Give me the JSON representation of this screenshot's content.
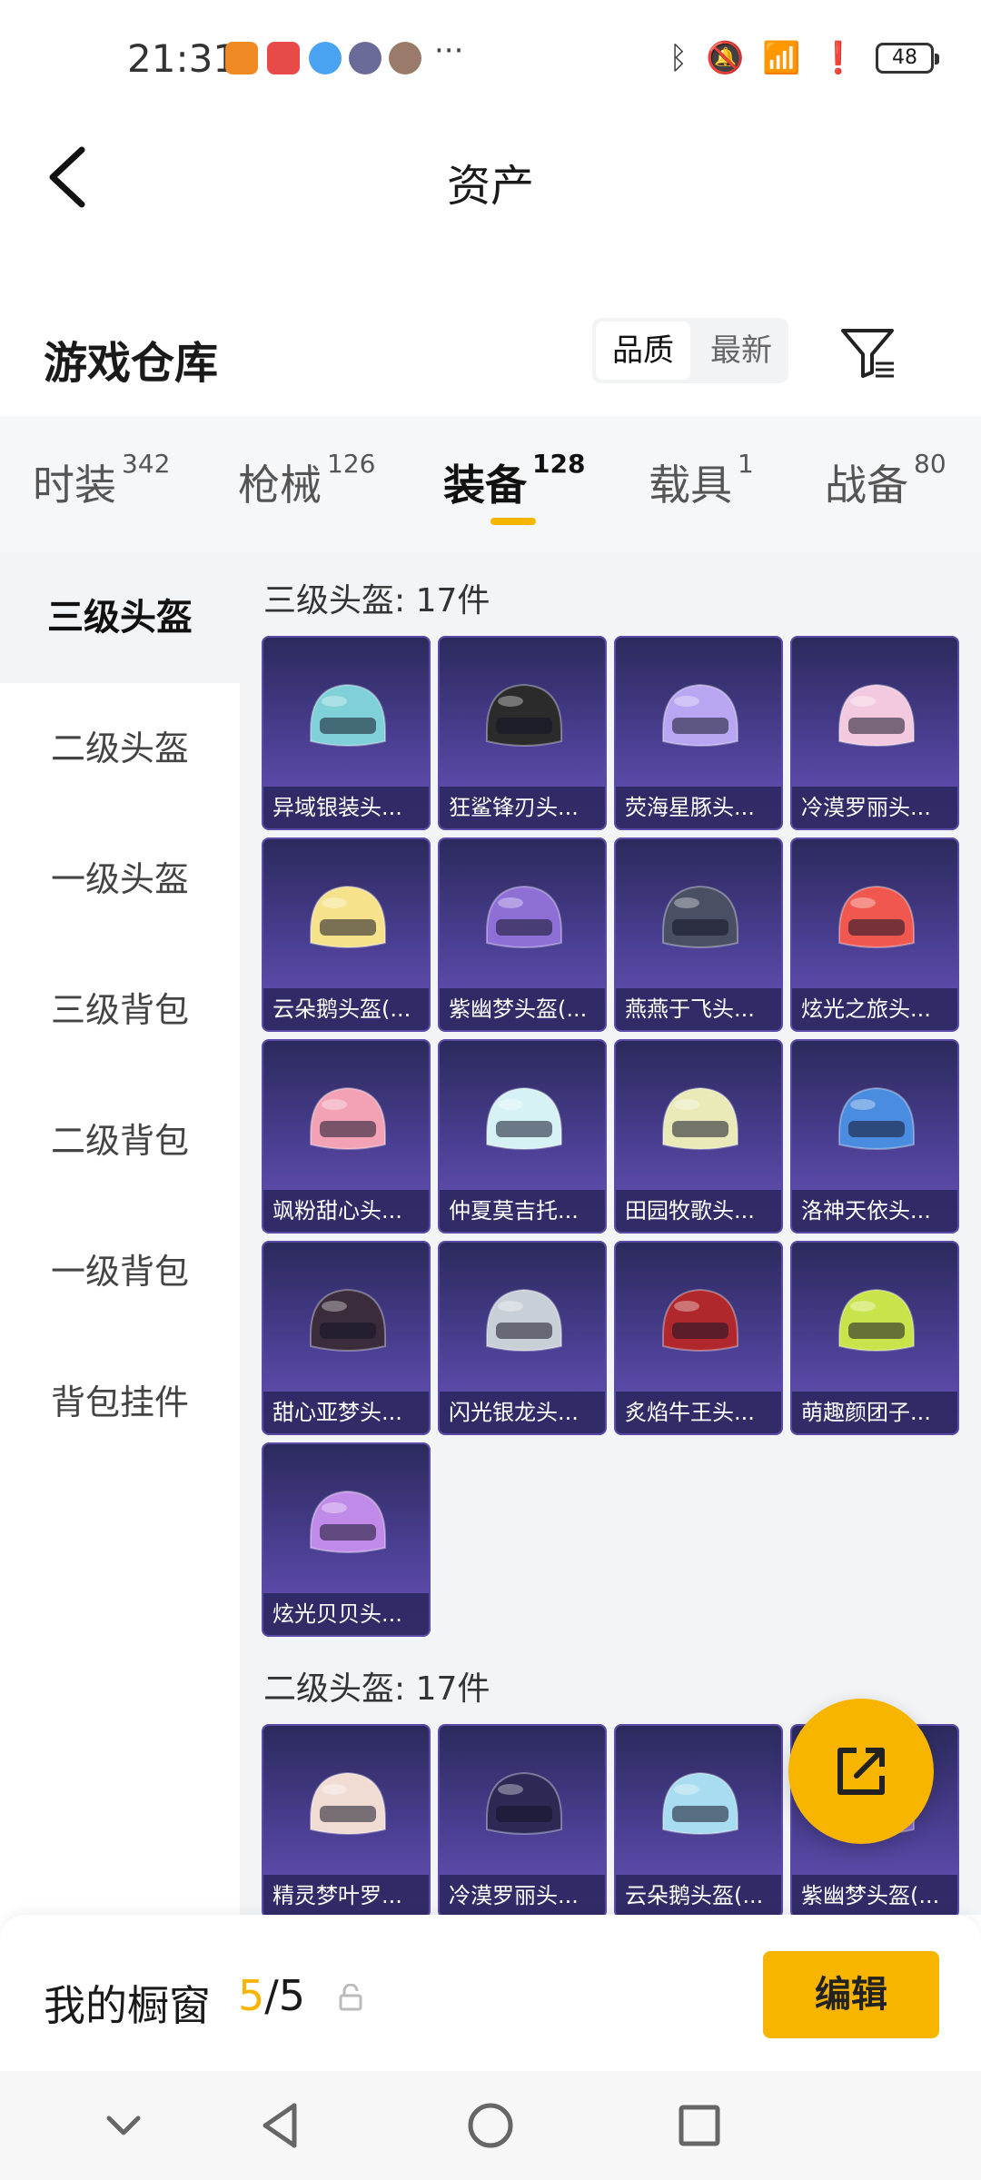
{
  "status": {
    "time": "21:31",
    "battery": "48",
    "notif_colors": [
      "#f08a24",
      "#e84a4a",
      "#4aa3f0",
      "#6b6b9a",
      "#9a7a6b"
    ]
  },
  "header": {
    "title": "资产"
  },
  "section": {
    "title": "游戏仓库",
    "sort_quality": "品质",
    "sort_newest": "最新"
  },
  "tabs": [
    {
      "label": "时装",
      "count": "342"
    },
    {
      "label": "枪械",
      "count": "126"
    },
    {
      "label": "装备",
      "count": "128"
    },
    {
      "label": "载具",
      "count": "1"
    },
    {
      "label": "战备",
      "count": "80"
    }
  ],
  "sidebar": [
    "三级头盔",
    "二级头盔",
    "一级头盔",
    "三级背包",
    "二级背包",
    "一级背包",
    "背包挂件"
  ],
  "groups": [
    {
      "title": "三级头盔: 17件",
      "items": [
        {
          "name": "异域银装头...",
          "color": "#7fd0d8"
        },
        {
          "name": "狂鲨锋刃头...",
          "color": "#2b2b2b"
        },
        {
          "name": "荧海星豚头...",
          "color": "#b9a6f2"
        },
        {
          "name": "冷漠罗丽头...",
          "color": "#f3c9df"
        },
        {
          "name": "云朵鹅头盔(...",
          "color": "#f5e28a"
        },
        {
          "name": "紫幽梦头盔(...",
          "color": "#8d6fd6"
        },
        {
          "name": "燕燕于飞头...",
          "color": "#4a4f63"
        },
        {
          "name": "炫光之旅头...",
          "color": "#f0584f"
        },
        {
          "name": "飒粉甜心头...",
          "color": "#f3a2b6"
        },
        {
          "name": "仲夏莫吉托...",
          "color": "#d6f2f5"
        },
        {
          "name": "田园牧歌头...",
          "color": "#e9eab8"
        },
        {
          "name": "洛神天依头...",
          "color": "#4a8de0"
        },
        {
          "name": "甜心亚梦头...",
          "color": "#3a2c3a"
        },
        {
          "name": "闪光银龙头...",
          "color": "#c9cfd6"
        },
        {
          "name": "炙焰牛王头...",
          "color": "#b1282c"
        },
        {
          "name": "萌趣颜团子...",
          "color": "#c9e34a"
        },
        {
          "name": "炫光贝贝头...",
          "color": "#c08be8"
        }
      ]
    },
    {
      "title": "二级头盔: 17件",
      "items": [
        {
          "name": "精灵梦叶罗...",
          "color": "#f1dcd4"
        },
        {
          "name": "冷漠罗丽头...",
          "color": "#2c2a55"
        },
        {
          "name": "云朵鹅头盔(...",
          "color": "#a8dcf0"
        },
        {
          "name": "紫幽梦头盔(...",
          "color": "#8d6fd6"
        }
      ]
    }
  ],
  "bottom": {
    "label": "我的橱窗",
    "count_current": "5",
    "count_total": "/5",
    "edit": "编辑"
  }
}
